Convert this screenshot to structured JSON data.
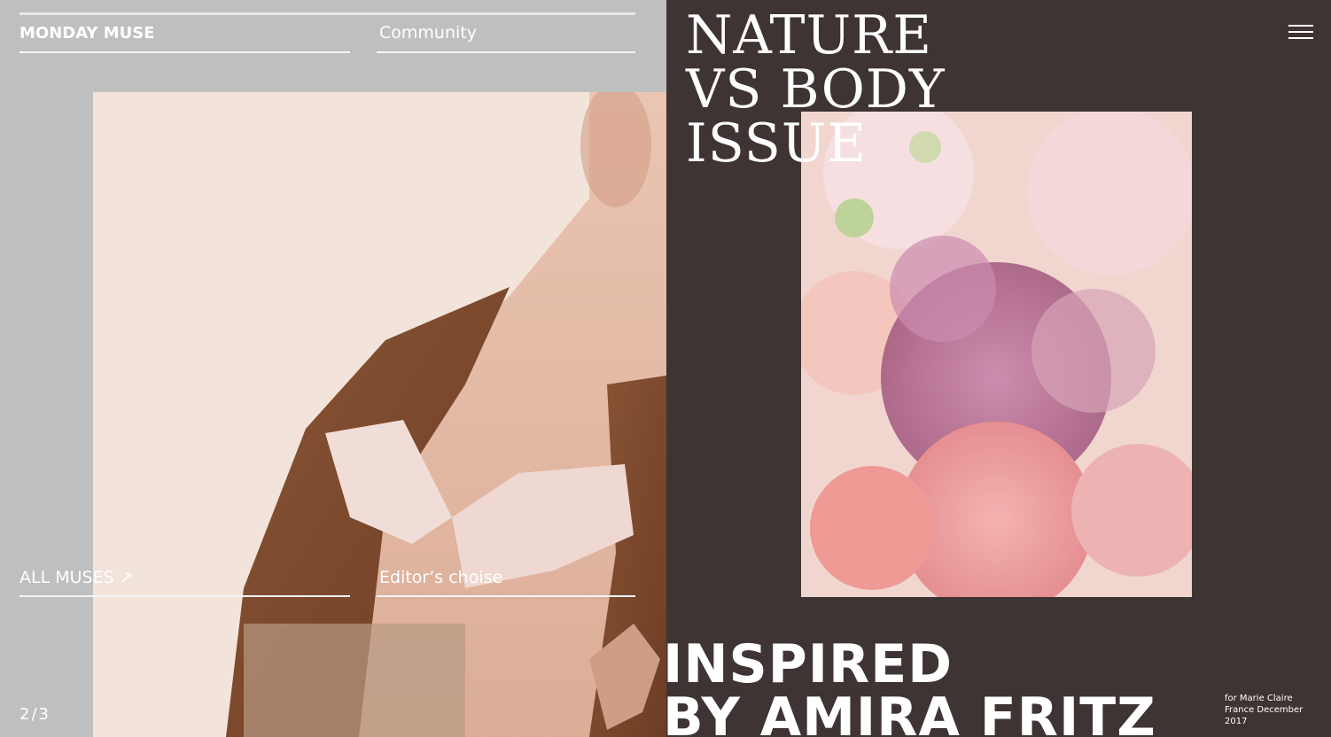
{
  "left": {
    "brand": "MONDAY MUSE",
    "nav_community": "Community",
    "all_muses": "ALL MUSES",
    "all_muses_icon": "arrow-up-right-icon",
    "editors_choice": "Editor’s choise",
    "page_counter": "2/3"
  },
  "right": {
    "issue_title": "NATURE\nVS BODY\nISSUE",
    "menu_icon": "hamburger-menu-icon",
    "headline_line1": "INSPIRED",
    "headline_line2": "BY AMIRA FRITZ",
    "credit": "for Marie Claire France December 2017"
  },
  "colors": {
    "left_bg": "#bfbfbf",
    "right_bg": "#3e3433",
    "text": "#ffffff"
  }
}
